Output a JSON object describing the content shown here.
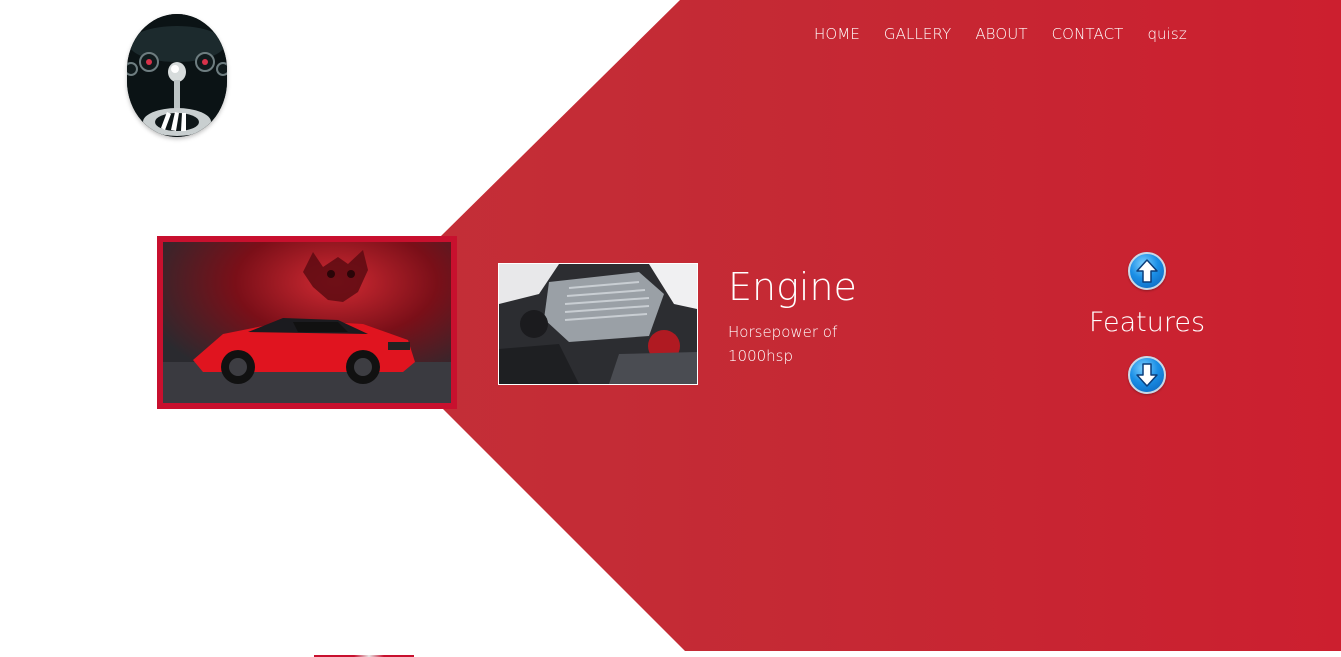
{
  "nav": {
    "items": [
      {
        "label": "HOME"
      },
      {
        "label": "GALLERY"
      },
      {
        "label": "ABOUT"
      },
      {
        "label": "CONTACT"
      },
      {
        "label": "quisz"
      }
    ]
  },
  "feature": {
    "title": "Engine",
    "description": "Horsepower of 1000hsp"
  },
  "features_nav": {
    "label": "Features",
    "up_icon": "arrow-up-circle-icon",
    "down_icon": "arrow-down-circle-icon"
  },
  "colors": {
    "accent_red": "#c8102e",
    "panel_red": "#c52934",
    "text_on_red": "#ffffff"
  },
  "images": {
    "logo": "gear-shifter-logo",
    "hero": "red-muscle-car-photo",
    "feature": "engine-bay-photo"
  }
}
